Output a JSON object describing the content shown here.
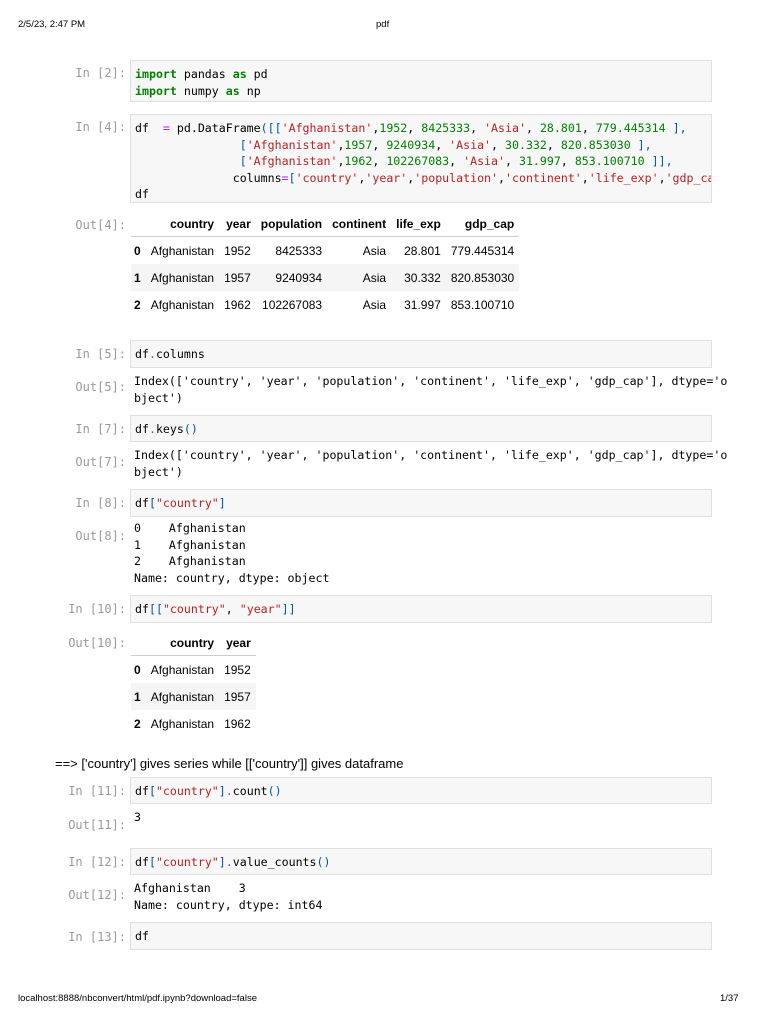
{
  "browser_header": {
    "datetime": "2/5/23, 2:47 PM",
    "title": "pdf"
  },
  "browser_footer": {
    "url": "localhost:8888/nbconvert/html/pdf.ipynb?download=false",
    "page": "1/37"
  },
  "cells": {
    "c2": {
      "prompt": "In [2]:",
      "code": [
        [
          [
            "import",
            "k"
          ],
          [
            " pandas ",
            "t"
          ],
          [
            "as",
            "k"
          ],
          [
            " pd",
            "t"
          ]
        ],
        [
          [
            "import",
            "k"
          ],
          [
            " numpy ",
            "t"
          ],
          [
            "as",
            "k"
          ],
          [
            " np",
            "t"
          ]
        ]
      ]
    },
    "c4": {
      "prompt": "In [4]:",
      "code": [
        [
          [
            "df  ",
            "t"
          ],
          [
            "=",
            "o"
          ],
          [
            " pd.DataFrame",
            "t"
          ],
          [
            "([[",
            "p"
          ],
          [
            "'Afghanistan'",
            "s"
          ],
          [
            ",",
            "t"
          ],
          [
            "1952",
            "n"
          ],
          [
            ", ",
            "t"
          ],
          [
            "8425333",
            "n"
          ],
          [
            ", ",
            "t"
          ],
          [
            "'Asia'",
            "s"
          ],
          [
            ", ",
            "t"
          ],
          [
            "28.801",
            "n"
          ],
          [
            ", ",
            "t"
          ],
          [
            "779.445314",
            "n"
          ],
          [
            " ],",
            "p"
          ]
        ],
        [
          [
            "               ",
            "t"
          ],
          [
            "[",
            "p"
          ],
          [
            "'Afghanistan'",
            "s"
          ],
          [
            ",",
            "t"
          ],
          [
            "1957",
            "n"
          ],
          [
            ", ",
            "t"
          ],
          [
            "9240934",
            "n"
          ],
          [
            ", ",
            "t"
          ],
          [
            "'Asia'",
            "s"
          ],
          [
            ", ",
            "t"
          ],
          [
            "30.332",
            "n"
          ],
          [
            ", ",
            "t"
          ],
          [
            "820.853030",
            "n"
          ],
          [
            " ],",
            "p"
          ]
        ],
        [
          [
            "               ",
            "t"
          ],
          [
            "[",
            "p"
          ],
          [
            "'Afghanistan'",
            "s"
          ],
          [
            ",",
            "t"
          ],
          [
            "1962",
            "n"
          ],
          [
            ", ",
            "t"
          ],
          [
            "102267083",
            "n"
          ],
          [
            ", ",
            "t"
          ],
          [
            "'Asia'",
            "s"
          ],
          [
            ", ",
            "t"
          ],
          [
            "31.997",
            "n"
          ],
          [
            ", ",
            "t"
          ],
          [
            "853.100710",
            "n"
          ],
          [
            " ]],",
            "p"
          ]
        ],
        [
          [
            "              columns",
            "t"
          ],
          [
            "=",
            "o"
          ],
          [
            "[",
            "p"
          ],
          [
            "'country'",
            "s"
          ],
          [
            ",",
            "t"
          ],
          [
            "'year'",
            "s"
          ],
          [
            ",",
            "t"
          ],
          [
            "'population'",
            "s"
          ],
          [
            ",",
            "t"
          ],
          [
            "'continent'",
            "s"
          ],
          [
            ",",
            "t"
          ],
          [
            "'life_exp'",
            "s"
          ],
          [
            ",",
            "t"
          ],
          [
            "'gdp_cap'",
            "s"
          ],
          [
            "])",
            "p"
          ]
        ],
        [
          [
            "df",
            "t"
          ]
        ]
      ]
    },
    "o4": {
      "prompt": "Out[4]:",
      "columns": [
        "",
        "country",
        "year",
        "population",
        "continent",
        "life_exp",
        "gdp_cap"
      ],
      "rows": [
        [
          "0",
          "Afghanistan",
          "1952",
          "8425333",
          "Asia",
          "28.801",
          "779.445314"
        ],
        [
          "1",
          "Afghanistan",
          "1957",
          "9240934",
          "Asia",
          "30.332",
          "820.853030"
        ],
        [
          "2",
          "Afghanistan",
          "1962",
          "102267083",
          "Asia",
          "31.997",
          "853.100710"
        ]
      ]
    },
    "c5": {
      "prompt": "In [5]:",
      "code": [
        [
          [
            "df",
            "t"
          ],
          [
            ".",
            "o"
          ],
          [
            "columns",
            "t"
          ]
        ]
      ]
    },
    "o5": {
      "prompt": "Out[5]:",
      "text": "Index(['country', 'year', 'population', 'continent', 'life_exp', 'gdp_cap'], dtype='o\nbject')"
    },
    "c7": {
      "prompt": "In [7]:",
      "code": [
        [
          [
            "df",
            "t"
          ],
          [
            ".",
            "o"
          ],
          [
            "keys",
            "t"
          ],
          [
            "()",
            "p"
          ]
        ]
      ]
    },
    "o7": {
      "prompt": "Out[7]:",
      "text": "Index(['country', 'year', 'population', 'continent', 'life_exp', 'gdp_cap'], dtype='o\nbject')"
    },
    "c8": {
      "prompt": "In [8]:",
      "code": [
        [
          [
            "df",
            "t"
          ],
          [
            "[",
            "p"
          ],
          [
            "\"country\"",
            "s"
          ],
          [
            "]",
            "p"
          ]
        ]
      ]
    },
    "o8": {
      "prompt": "Out[8]:",
      "text": "0    Afghanistan\n1    Afghanistan\n2    Afghanistan\nName: country, dtype: object"
    },
    "c10": {
      "prompt": "In [10]:",
      "code": [
        [
          [
            "df",
            "t"
          ],
          [
            "[[",
            "p"
          ],
          [
            "\"country\"",
            "s"
          ],
          [
            ", ",
            "t"
          ],
          [
            "\"year\"",
            "s"
          ],
          [
            "]]",
            "p"
          ]
        ]
      ]
    },
    "o10": {
      "prompt": "Out[10]:",
      "columns": [
        "",
        "country",
        "year"
      ],
      "rows": [
        [
          "0",
          "Afghanistan",
          "1952"
        ],
        [
          "1",
          "Afghanistan",
          "1957"
        ],
        [
          "2",
          "Afghanistan",
          "1962"
        ]
      ]
    },
    "c11": {
      "prompt": "In [11]:",
      "code": [
        [
          [
            "df",
            "t"
          ],
          [
            "[",
            "p"
          ],
          [
            "\"country\"",
            "s"
          ],
          [
            "]",
            "p"
          ],
          [
            ".",
            "o"
          ],
          [
            "count",
            "t"
          ],
          [
            "()",
            "p"
          ]
        ]
      ]
    },
    "o11": {
      "prompt": "Out[11]:",
      "text": "3"
    },
    "c12": {
      "prompt": "In [12]:",
      "code": [
        [
          [
            "df",
            "t"
          ],
          [
            "[",
            "p"
          ],
          [
            "\"country\"",
            "s"
          ],
          [
            "]",
            "p"
          ],
          [
            ".",
            "o"
          ],
          [
            "value_counts",
            "t"
          ],
          [
            "()",
            "p"
          ]
        ]
      ]
    },
    "o12": {
      "prompt": "Out[12]:",
      "text": "Afghanistan    3\nName: country, dtype: int64"
    },
    "c13": {
      "prompt": "In [13]:",
      "code": [
        [
          [
            "df",
            "t"
          ]
        ]
      ]
    }
  },
  "note": "==> ['country'] gives series while [['country']] gives dataframe"
}
